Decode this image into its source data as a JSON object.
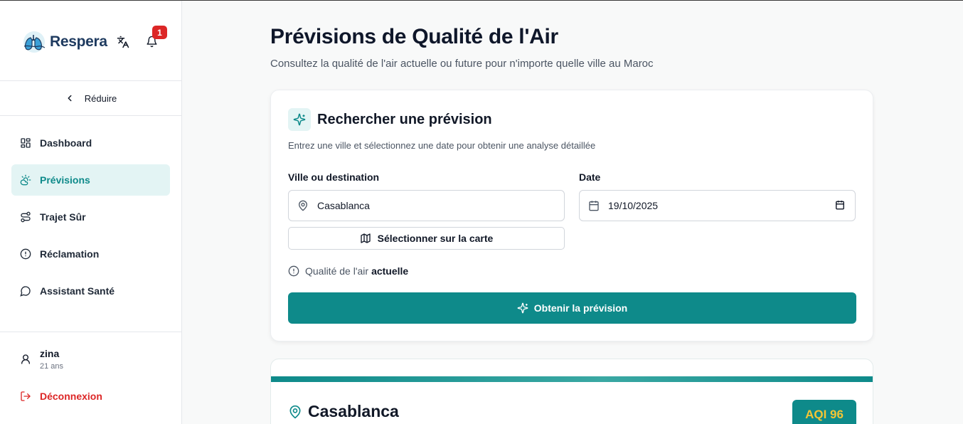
{
  "sidebar": {
    "brand": "Respera",
    "notifications_count": "1",
    "collapse_label": "Réduire",
    "items": [
      {
        "label": "Dashboard",
        "icon": "dashboard-icon"
      },
      {
        "label": "Prévisions",
        "icon": "weather-icon",
        "active": true
      },
      {
        "label": "Trajet Sûr",
        "icon": "route-icon"
      },
      {
        "label": "Réclamation",
        "icon": "alert-circle-icon"
      },
      {
        "label": "Assistant Santé",
        "icon": "chat-icon"
      }
    ],
    "user": {
      "name": "zina",
      "age": "21 ans"
    },
    "logout_label": "Déconnexion"
  },
  "header": {
    "title": "Prévisions de Qualité de l'Air",
    "subtitle": "Consultez la qualité de l'air actuelle ou future pour n'importe quelle ville au Maroc"
  },
  "search_card": {
    "title": "Rechercher une prévision",
    "description": "Entrez une ville et sélectionnez une date pour obtenir une analyse détaillée",
    "city_label": "Ville ou destination",
    "city_value": "Casablanca",
    "date_label": "Date",
    "date_value": "19/10/2025",
    "map_button": "Sélectionner sur la carte",
    "note_prefix": "Qualité de l'air",
    "note_emphasis": "actuelle",
    "submit_label": "Obtenir la prévision"
  },
  "result": {
    "city": "Casablanca",
    "aqi": "AQI 96"
  },
  "colors": {
    "accent": "#0e8a8a",
    "accent_light": "#e3f4f4",
    "danger": "#dc2626",
    "aqi_text": "#f4c534"
  }
}
